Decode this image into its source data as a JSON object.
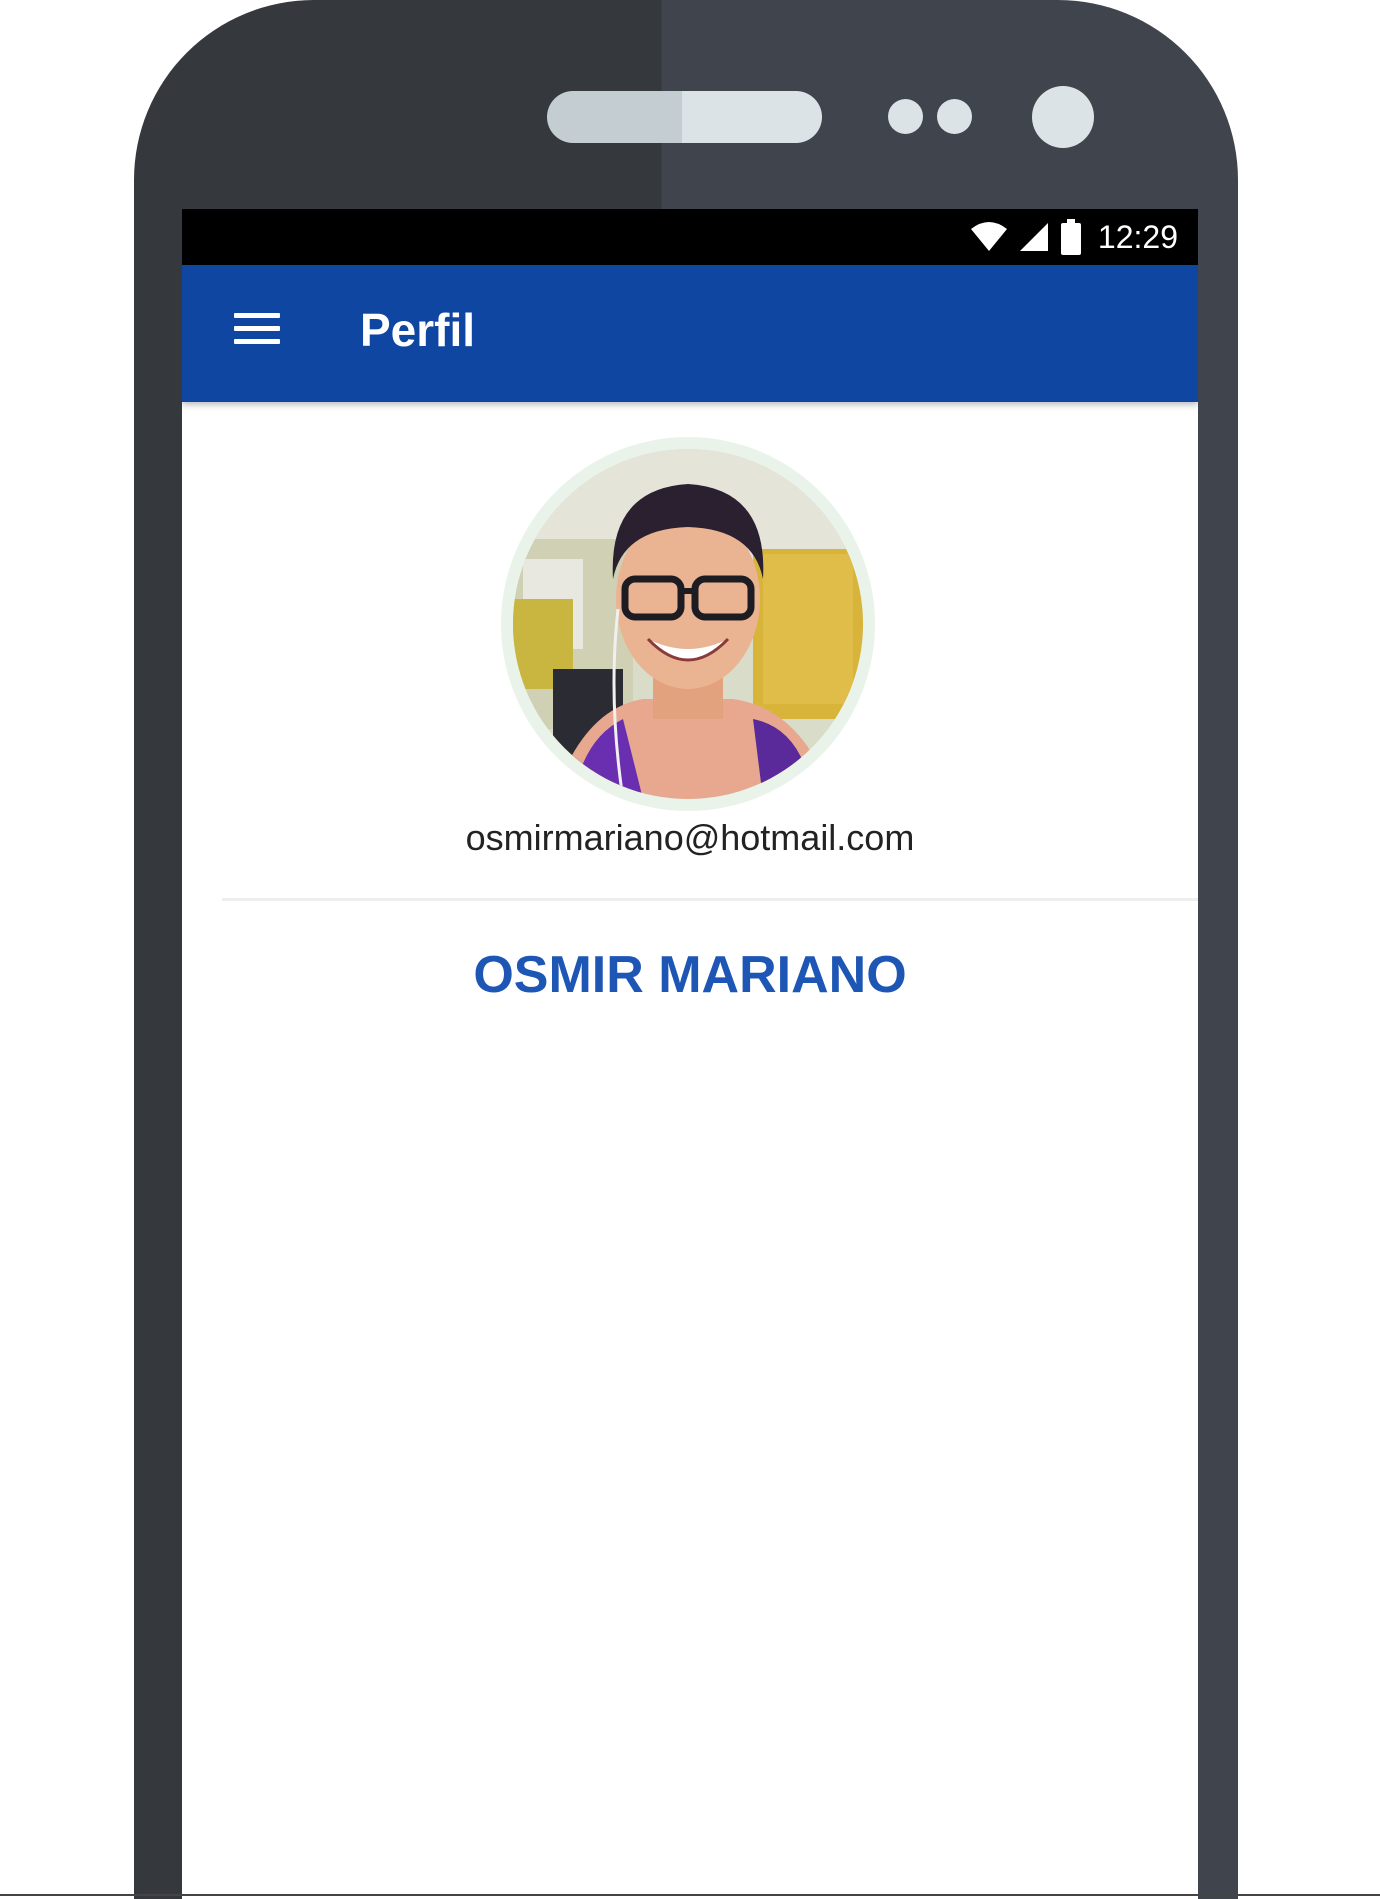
{
  "status_bar": {
    "time": "12:29",
    "icons": [
      "wifi-icon",
      "cell-signal-icon",
      "battery-icon"
    ]
  },
  "app_bar": {
    "title": "Perfil",
    "menu_icon": "menu-icon",
    "color": "#0f46a2"
  },
  "profile": {
    "email": "osmirmariano@hotmail.com",
    "name": "OSMIR MARIANO",
    "name_color": "#1d56b4"
  }
}
